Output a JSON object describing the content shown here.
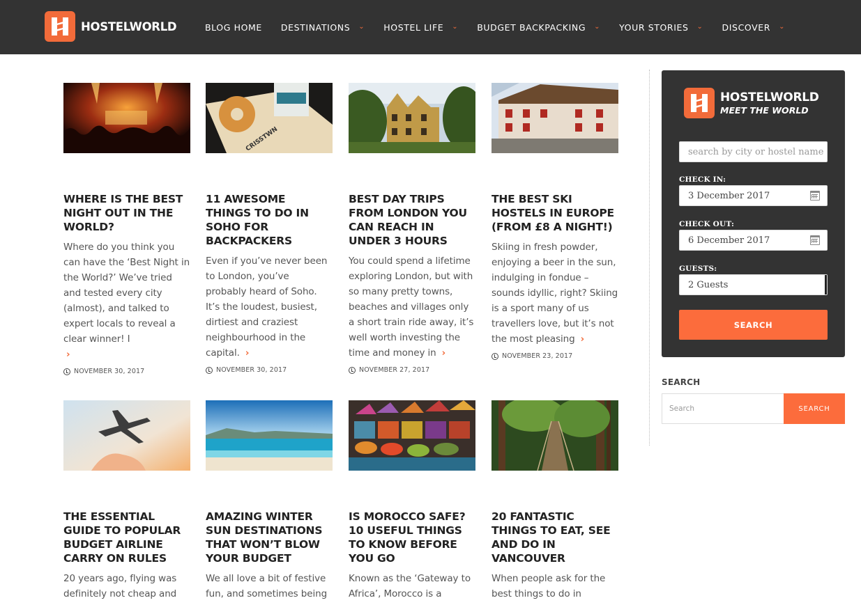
{
  "header": {
    "logo_text": "HOSTELWORLD",
    "nav": [
      {
        "label": "BLOG HOME",
        "dropdown": false
      },
      {
        "label": "DESTINATIONS",
        "dropdown": true
      },
      {
        "label": "HOSTEL LIFE",
        "dropdown": true
      },
      {
        "label": "BUDGET BACKPACKING",
        "dropdown": true
      },
      {
        "label": "YOUR STORIES",
        "dropdown": true
      },
      {
        "label": "DISCOVER",
        "dropdown": true
      }
    ]
  },
  "posts": [
    {
      "title": "WHERE IS THE BEST NIGHT OUT IN THE WORLD?",
      "excerpt": "Where do you think you can have the ‘Best Night in the World?’ We’ve tried and tested every city (almost), and talked to expert locals to reveal a clear winner! I",
      "date": "NOVEMBER 30, 2017",
      "image": "concert-crowd-image"
    },
    {
      "title": "11 AWESOME THINGS TO DO IN SOHO FOR BACKPACKERS",
      "excerpt": "Even if you’ve never been to London, you’ve probably heard of Soho. It’s the loudest, busiest, dirtiest and craziest neighbourhood in the capital.",
      "date": "NOVEMBER 30, 2017",
      "image": "doughnut-coffee-image",
      "image_text": "CRISSTWN"
    },
    {
      "title": "BEST DAY TRIPS FROM LONDON YOU CAN REACH IN UNDER 3 HOURS",
      "excerpt": "You could spend a lifetime exploring London, but with so many pretty towns, beaches and villages only a short train ride away, it’s well worth investing the time and money in",
      "date": "NOVEMBER 27, 2017",
      "image": "cotswold-manor-image"
    },
    {
      "title": "THE BEST SKI HOSTELS IN EUROPE (FROM £8 A NIGHT!)",
      "excerpt": "Skiing in fresh powder, enjoying a beer in the sun, indulging in fondue – sounds idyllic, right? Skiing is a sport many of us travellers love, but it’s not the most pleasing",
      "date": "NOVEMBER 23, 2017",
      "image": "ski-chalet-image"
    },
    {
      "title": "THE ESSENTIAL GUIDE TO POPULAR BUDGET AIRLINE CARRY ON RULES",
      "excerpt": "20 years ago, flying was definitely not cheap and",
      "image": "airplane-hand-image"
    },
    {
      "title": "AMAZING WINTER SUN DESTINATIONS THAT WON’T BLOW YOUR BUDGET",
      "excerpt": "We all love a bit of festive fun, and sometimes being",
      "image": "beach-image"
    },
    {
      "title": "IS MOROCCO SAFE? 10 USEFUL THINGS TO KNOW BEFORE YOU GO",
      "excerpt": "Known as the ‘Gateway to Africa’, Morocco is a",
      "image": "spice-market-image"
    },
    {
      "title": "20 FANTASTIC THINGS TO EAT, SEE AND DO IN VANCOUVER",
      "excerpt": "When people ask for the best things to do in Vancouver it’s hard to give",
      "image": "suspension-bridge-image"
    }
  ],
  "booking_widget": {
    "brand": "HOSTELWORLD",
    "tagline": "MEET THE WORLD",
    "search_placeholder": "search by city or hostel name",
    "check_in_label": "CHECK IN:",
    "check_in_value": "3 December 2017",
    "check_out_label": "CHECK OUT:",
    "check_out_value": "6 December 2017",
    "guests_label": "GUESTS:",
    "guests_value": "2 Guests",
    "button_label": "SEARCH"
  },
  "sidebar_search": {
    "title": "SEARCH",
    "placeholder": "Search",
    "button_label": "SEARCH"
  },
  "colors": {
    "accent": "#fc6c3c",
    "header_bg": "#333333",
    "widget_bg": "#333333"
  }
}
